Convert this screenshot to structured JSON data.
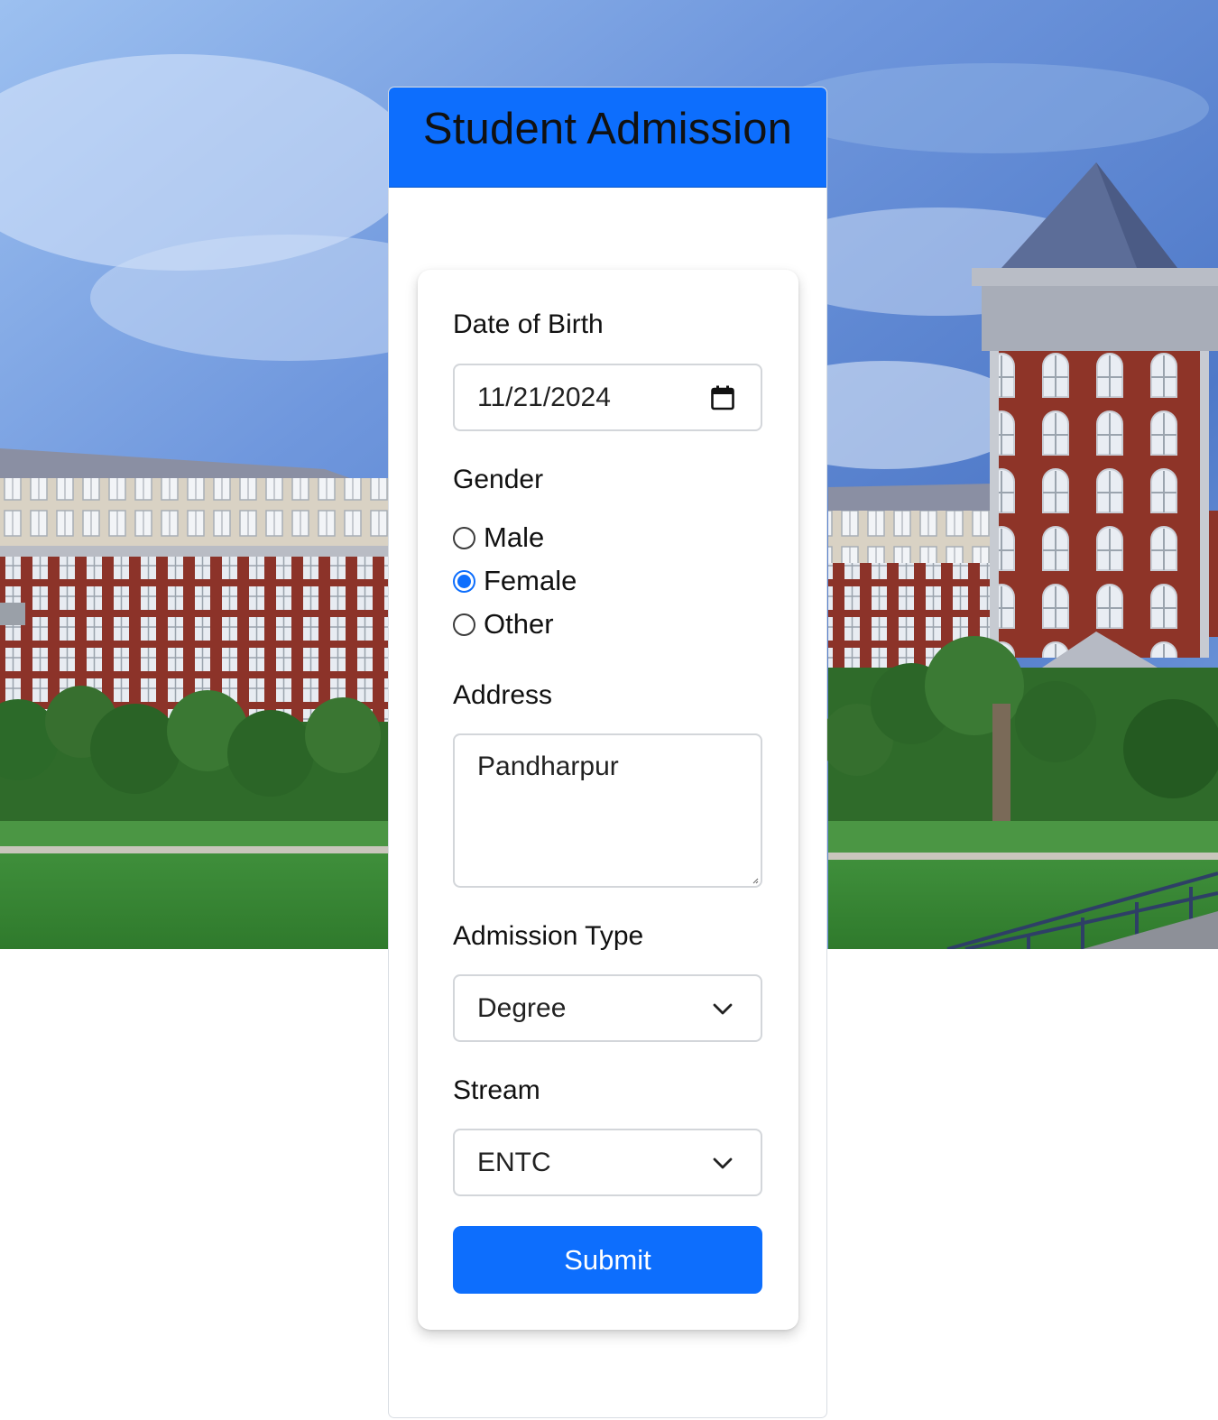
{
  "header": {
    "title": "Student Admission"
  },
  "colors": {
    "primary": "#0d6efd",
    "card_bg": "#ffffff",
    "text": "#111111"
  },
  "form": {
    "dob": {
      "label": "Date of Birth",
      "value": "11/21/2024",
      "icon": "calendar-icon"
    },
    "gender": {
      "label": "Gender",
      "options": [
        "Male",
        "Female",
        "Other"
      ],
      "selected": "Female"
    },
    "address": {
      "label": "Address",
      "value": "Pandharpur"
    },
    "admission_type": {
      "label": "Admission Type",
      "selected": "Degree",
      "icon": "chevron-down-icon"
    },
    "stream": {
      "label": "Stream",
      "selected": "ENTC",
      "icon": "chevron-down-icon"
    },
    "submit_label": "Submit"
  }
}
